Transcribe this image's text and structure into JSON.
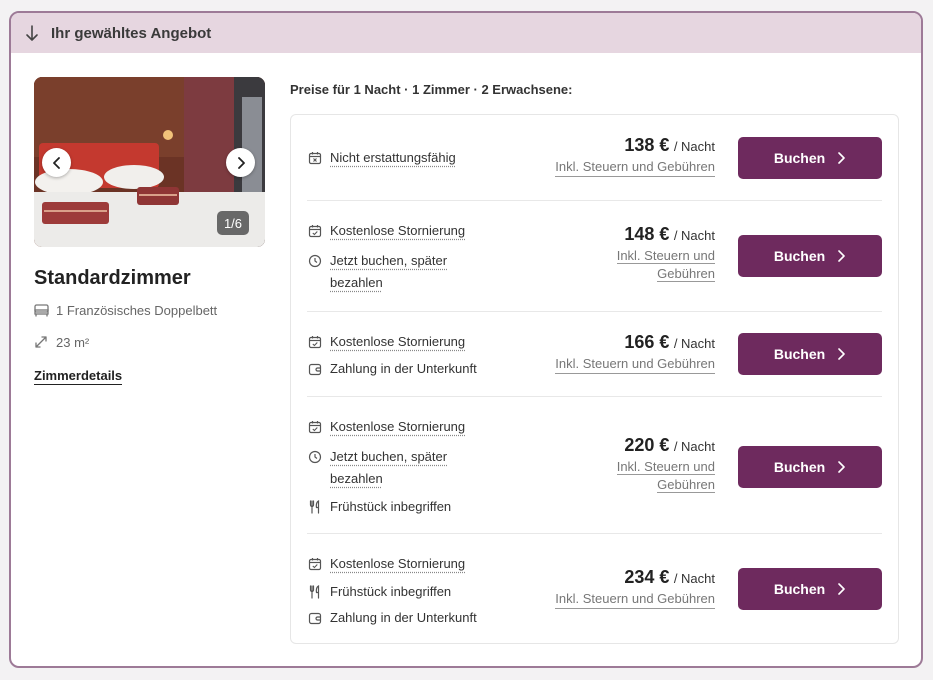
{
  "header": {
    "title": "Ihr gewähltes Angebot"
  },
  "room": {
    "image_counter": "1/6",
    "title": "Standardzimmer",
    "bed": "1 Französisches Doppelbett",
    "size": "23 m²",
    "details_link": "Zimmerdetails"
  },
  "prices_caption": "Preise für 1 Nacht · 1 Zimmer · 2 Erwachsene:",
  "rates": [
    {
      "features": [
        {
          "icon": "calendar-cancel-icon",
          "text": "Nicht erstattungsfähig"
        }
      ],
      "price": "138 €",
      "per": "/ Nacht",
      "tax": "Inkl. Steuern und Gebühren",
      "button": "Buchen"
    },
    {
      "features": [
        {
          "icon": "calendar-check-icon",
          "text": "Kostenlose Stornierung"
        },
        {
          "icon": "clock-icon",
          "text": "Jetzt buchen, später bezahlen"
        }
      ],
      "price": "148 €",
      "per": "/ Nacht",
      "tax": "Inkl. Steuern und Gebühren",
      "button": "Buchen"
    },
    {
      "features": [
        {
          "icon": "calendar-check-icon",
          "text": "Kostenlose Stornierung"
        },
        {
          "icon": "wallet-icon",
          "text": "Zahlung in der Unterkunft"
        }
      ],
      "price": "166 €",
      "per": "/ Nacht",
      "tax": "Inkl. Steuern und Gebühren",
      "button": "Buchen"
    },
    {
      "features": [
        {
          "icon": "calendar-check-icon",
          "text": "Kostenlose Stornierung"
        },
        {
          "icon": "clock-icon",
          "text": "Jetzt buchen, später bezahlen"
        },
        {
          "icon": "cutlery-icon",
          "text": "Frühstück inbegriffen"
        }
      ],
      "price": "220 €",
      "per": "/ Nacht",
      "tax": "Inkl. Steuern und Gebühren",
      "button": "Buchen"
    },
    {
      "features": [
        {
          "icon": "calendar-check-icon",
          "text": "Kostenlose Stornierung"
        },
        {
          "icon": "cutlery-icon",
          "text": "Frühstück inbegriffen"
        },
        {
          "icon": "wallet-icon",
          "text": "Zahlung in der Unterkunft"
        }
      ],
      "price": "234 €",
      "per": "/ Nacht",
      "tax": "Inkl. Steuern und Gebühren",
      "button": "Buchen"
    }
  ],
  "colors": {
    "accent": "#6e2a5e",
    "header_bg": "#e6d6e0",
    "border": "#9d7a97"
  }
}
